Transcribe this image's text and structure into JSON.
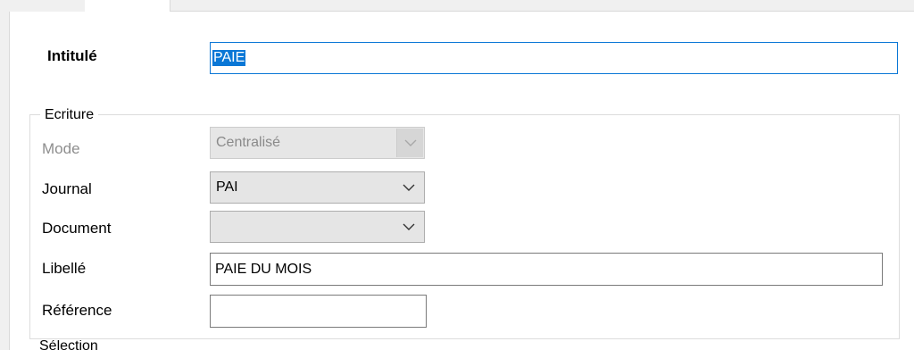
{
  "form": {
    "intitule_label": "Intitulé",
    "intitule_value": "PAIE"
  },
  "ecriture": {
    "legend": "Ecriture",
    "mode_label": "Mode",
    "mode_value": "Centralisé",
    "journal_label": "Journal",
    "journal_value": "PAI",
    "document_label": "Document",
    "document_value": "",
    "libelle_label": "Libellé",
    "libelle_value": "PAIE DU MOIS",
    "reference_label": "Référence",
    "reference_value": ""
  },
  "next_section": {
    "legend": "Sélection"
  }
}
